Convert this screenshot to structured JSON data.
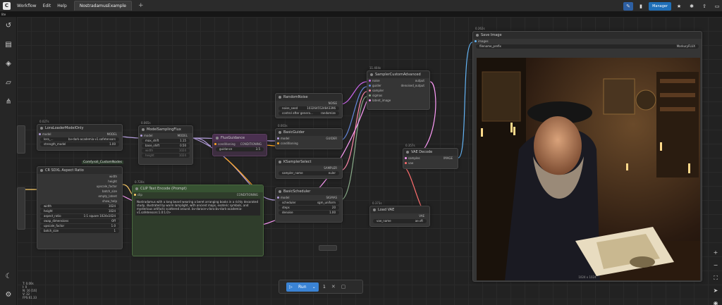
{
  "menu": {
    "workflow": "Workflow",
    "edit": "Edit",
    "help": "Help"
  },
  "tab": {
    "label": "NostradamusExample",
    "add": "+"
  },
  "toolbar": {
    "manager": "Manager"
  },
  "subbar": {
    "label": "lite"
  },
  "nodes": {
    "lora": {
      "badge": "0.027s",
      "title": "LoraLoaderModelOnly",
      "in_model": "model",
      "out_model": "MODEL",
      "lora_name": "lora_...",
      "lora_value": "bv-dark-academia-v1.safetensors",
      "strength_label": "strength_model",
      "strength_value": "1.00"
    },
    "sampling": {
      "badge": "0.065s",
      "title": "ModelSamplingFlux",
      "in_model": "model",
      "out_model": "MODEL",
      "w1": "max_shift",
      "v1": "1.15",
      "w2": "base_shift",
      "v2": "0.50",
      "w3": "width",
      "v3": "1024",
      "w4": "height",
      "v4": "1024"
    },
    "guidance": {
      "title": "FluxGuidance",
      "in": "conditioning",
      "out": "CONDITIONING",
      "w": "guidance",
      "v": "3.5"
    },
    "noise": {
      "title": "RandomNoise",
      "out": "NOISE",
      "w1": "noise_seed",
      "v1": "1032645524843396",
      "w2": "control after genera...",
      "v2": "randomize"
    },
    "guider": {
      "badge": "0.003s",
      "title": "BasicGuider",
      "in1": "model",
      "in2": "conditioning",
      "out": "GUIDER"
    },
    "ksampler": {
      "title": "KSamplerSelect",
      "out": "SAMPLER",
      "w": "sampler_name",
      "v": "euler"
    },
    "scheduler": {
      "title": "BasicScheduler",
      "in": "model",
      "out": "SIGMAS",
      "w1": "scheduler",
      "v1": "sgm_uniform",
      "w2": "steps",
      "v2": "20",
      "w3": "denoise",
      "v3": "1.00"
    },
    "sca": {
      "badge": "11.404s",
      "title": "SamplerCustomAdvanced",
      "in1": "noise",
      "in2": "guider",
      "in3": "sampler",
      "in4": "sigmas",
      "in5": "latent_image",
      "out1": "output",
      "out2": "denoised_output"
    },
    "vaedecode": {
      "badge": "0.357s",
      "title": "VAE Decode",
      "in1": "samples",
      "in2": "vae",
      "out": "IMAGE"
    },
    "vaeload": {
      "badge": "0.373s",
      "title": "Load VAE",
      "out": "VAE",
      "w": "vae_name",
      "v": "ae.sft"
    },
    "save": {
      "badge": "0.262s",
      "title": "Save Image",
      "in": "images",
      "w": "filename_prefix",
      "v": "MarkuryFLUX",
      "caption": "1024 x 1024"
    },
    "aspect": {
      "title": "CR SDXL Aspect Ratio",
      "o1": "width",
      "o2": "height",
      "o3": "upscale_factor",
      "o4": "batch_size",
      "o5": "empty_latent",
      "o6": "show_help",
      "w1": "width",
      "v1": "1024",
      "w2": "height",
      "v2": "1024",
      "w3": "aspect_ratio",
      "v3": "1:1 square 1024x1024",
      "w4": "swap_dimensions",
      "v4": "Off",
      "w5": "upscale_factor",
      "v5": "1.0",
      "w6": "batch_size",
      "v6": "1"
    },
    "clip": {
      "badge": "0.720s",
      "title": "CLIP Text Encode (Prompt)",
      "in": "clip",
      "out": "CONDITIONING",
      "text": "Nostradamus with a long beard wearing a beret arranging books in a richly decorated study, illustrated by warm lamplight, with ancient maps, esoteric symbols, and mysterious artifacts scattered around. bv-darace-v:lora:bv-dark-academia-v1.safetensors:1.0:1.0>"
    }
  },
  "group": {
    "label": "Comfyroll_CustomNodes"
  },
  "runbar": {
    "run": "Run",
    "count": "1"
  },
  "bottom_info": {
    "l1": "T: 0.00s",
    "l2": "I: 0",
    "l3": "N: 16 [16]",
    "l4": "V: 32",
    "l5": "FPS:61.33"
  },
  "colors": {
    "accent": "#3a83d4",
    "wire_model": "#b39ddb",
    "wire_cond": "#ffa726",
    "wire_latent": "#ff9cf9",
    "wire_image": "#64b5f6",
    "wire_vae": "#ff6e6e"
  }
}
